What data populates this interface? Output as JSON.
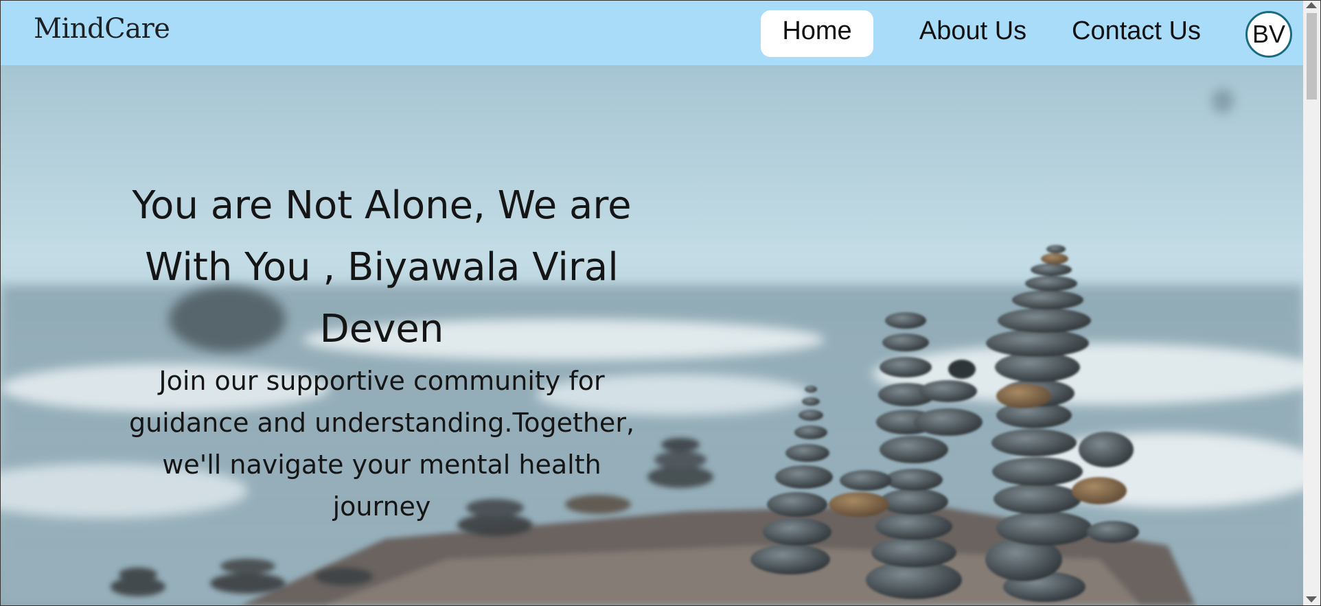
{
  "brand": {
    "name": "MindCare"
  },
  "nav": {
    "home": "Home",
    "about": "About Us",
    "contact": "Contact Us",
    "active": "Home"
  },
  "user": {
    "initials": "BV"
  },
  "hero": {
    "headline": "You are Not Alone, We are With You , Biyawala Viral Deven",
    "subtext": "Join our supportive community for guidance and understanding.Together, we'll navigate your mental health journey",
    "background": "stacked-stones-beach-photo"
  },
  "colors": {
    "navbar": "#a9dcf9",
    "active_tab": "#ffffff",
    "avatar_border": "#1b6b80"
  }
}
